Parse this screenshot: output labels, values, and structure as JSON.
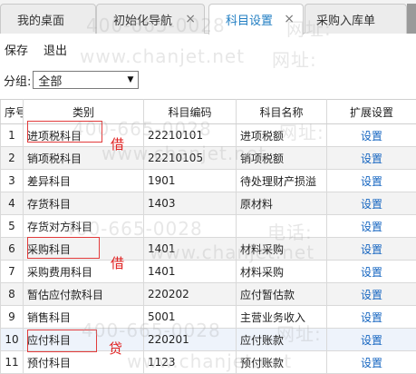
{
  "tabs": [
    {
      "label": "我的桌面",
      "closable": false
    },
    {
      "label": "初始化导航",
      "closable": true
    },
    {
      "label": "科目设置",
      "closable": true,
      "active": true
    },
    {
      "label": "采购入库单",
      "closable": false
    }
  ],
  "tab_close_glyph": "×",
  "toolbar": {
    "save_label": "保存",
    "exit_label": "退出"
  },
  "filter": {
    "label": "分组:",
    "value": "全部"
  },
  "grid": {
    "headers": [
      "序号",
      "类别",
      "科目编码",
      "科目名称",
      "扩展设置"
    ],
    "rows": [
      {
        "no": "1",
        "category": "进项税科目",
        "code": "22210101",
        "name": "进项税额",
        "action": "设置"
      },
      {
        "no": "2",
        "category": "销项税科目",
        "code": "22210105",
        "name": "销项税额",
        "action": "设置"
      },
      {
        "no": "3",
        "category": "差异科目",
        "code": "1901",
        "name": "待处理财产损溢",
        "action": "设置"
      },
      {
        "no": "4",
        "category": "存货科目",
        "code": "1403",
        "name": "原材料",
        "action": "设置"
      },
      {
        "no": "5",
        "category": "存货对方科目",
        "code": "",
        "name": "",
        "action": "设置"
      },
      {
        "no": "6",
        "category": "采购科目",
        "code": "1401",
        "name": "材料采购",
        "action": "设置"
      },
      {
        "no": "7",
        "category": "采购费用科目",
        "code": "1401",
        "name": "材料采购",
        "action": "设置"
      },
      {
        "no": "8",
        "category": "暂估应付款科目",
        "code": "220202",
        "name": "应付暂估款",
        "action": "设置"
      },
      {
        "no": "9",
        "category": "销售科目",
        "code": "5001",
        "name": "主营业务收入",
        "action": "设置"
      },
      {
        "no": "10",
        "category": "应付科目",
        "code": "220201",
        "name": "应付账款",
        "action": "设置"
      },
      {
        "no": "11",
        "category": "预付科目",
        "code": "1123",
        "name": "预付账款",
        "action": "设置"
      }
    ]
  },
  "annotations": {
    "debit_1": "借",
    "debit_2": "借",
    "credit": "贷"
  },
  "watermark": {
    "site": "www.chanjet.net",
    "site_label": "网址:",
    "phone_label": "电话:",
    "phone": "400-665-0028"
  },
  "colors": {
    "accent": "#1f7dc2",
    "link": "#1565c0",
    "mark": "#e02020"
  }
}
